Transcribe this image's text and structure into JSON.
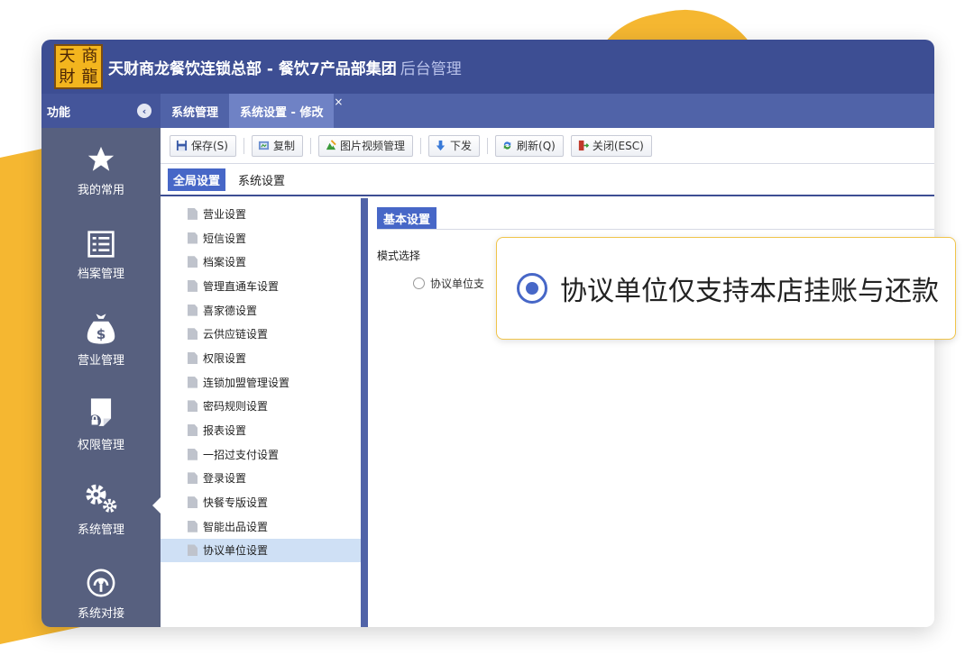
{
  "app": {
    "logo_chars": [
      "天",
      "商",
      "財",
      "龍"
    ],
    "title": "天财商龙餐饮连锁总部 - 餐饮7产品部集团",
    "title_suffix": "后台管理"
  },
  "tabbar": {
    "func_label": "功能",
    "tabs": [
      {
        "label": "系统管理"
      },
      {
        "label": "系统设置 - 修改"
      }
    ],
    "close_glyph": "×"
  },
  "sidebar": {
    "items": [
      {
        "label": "我的常用",
        "icon": "star-icon"
      },
      {
        "label": "档案管理",
        "icon": "list-icon"
      },
      {
        "label": "营业管理",
        "icon": "money-bag-icon"
      },
      {
        "label": "权限管理",
        "icon": "lock-doc-icon"
      },
      {
        "label": "系统管理",
        "icon": "gears-icon"
      },
      {
        "label": "系统对接",
        "icon": "podcast-icon"
      }
    ]
  },
  "toolbar": {
    "buttons": [
      {
        "label": "保存(S)",
        "icon": "save-icon"
      },
      {
        "label": "复制",
        "icon": "copy-icon"
      },
      {
        "label": "图片视频管理",
        "icon": "image-icon"
      },
      {
        "label": "下发",
        "icon": "download-arrow-icon"
      },
      {
        "label": "刷新(Q)",
        "icon": "refresh-icon"
      },
      {
        "label": "关闭(ESC)",
        "icon": "close-door-icon"
      }
    ]
  },
  "subtabs": [
    {
      "label": "全局设置"
    },
    {
      "label": "系统设置"
    }
  ],
  "tree": {
    "items": [
      "营业设置",
      "短信设置",
      "档案设置",
      "管理直通车设置",
      "喜家德设置",
      "云供应链设置",
      "权限设置",
      "连锁加盟管理设置",
      "密码规则设置",
      "报表设置",
      "一招过支付设置",
      "登录设置",
      "快餐专版设置",
      "智能出品设置",
      "协议单位设置"
    ],
    "selected_index": 14
  },
  "panel": {
    "title": "基本设置",
    "field_label": "模式选择",
    "option_partial": "协议单位支"
  },
  "callout": {
    "option_label": "协议单位仅支持本店挂账与还款"
  },
  "colors": {
    "titlebar": "#3d4e93",
    "accent": "#4767c7",
    "sidebar": "#57607f",
    "background_shape": "#f5b731"
  }
}
